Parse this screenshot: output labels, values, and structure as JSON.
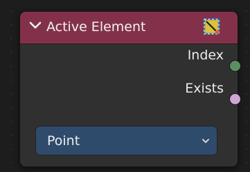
{
  "node": {
    "title": "Active Element",
    "collapse_icon": "chevron-down-icon",
    "type_icon": "selection-icon",
    "header_color": "#83314a",
    "outputs": [
      {
        "label": "Index",
        "socket_color": "#5a8f63"
      },
      {
        "label": "Exists",
        "socket_color": "#cca6d6"
      }
    ],
    "domain": {
      "selected": "Point",
      "arrow_icon": "chevron-down-icon"
    }
  }
}
